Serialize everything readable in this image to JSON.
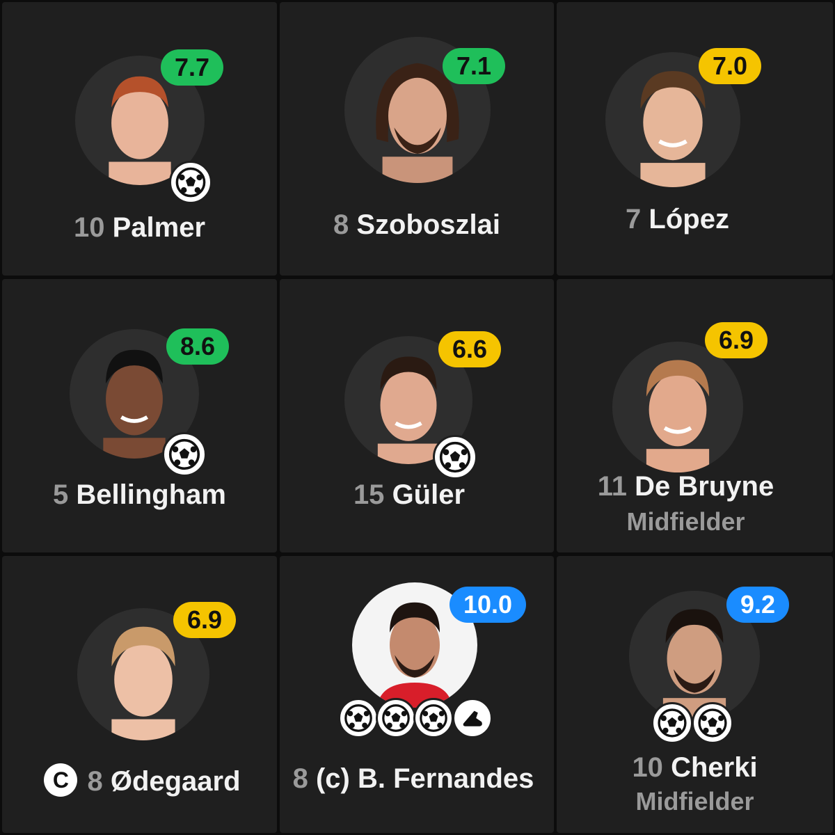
{
  "colors": {
    "green": "#1fbf5a",
    "yellow": "#f5c400",
    "blue": "#1a8cff",
    "card": "#1f1f1f"
  },
  "players": [
    {
      "number": "10",
      "name": "Palmer",
      "rating": "7.7",
      "rating_color": "green",
      "icons": [
        "ball-icon"
      ]
    },
    {
      "number": "8",
      "name": "Szoboszlai",
      "rating": "7.1",
      "rating_color": "green",
      "icons": []
    },
    {
      "number": "7",
      "name": "López",
      "rating": "7.0",
      "rating_color": "yellow",
      "icons": []
    },
    {
      "number": "5",
      "name": "Bellingham",
      "rating": "8.6",
      "rating_color": "green",
      "icons": [
        "ball-icon"
      ]
    },
    {
      "number": "15",
      "name": "Güler",
      "rating": "6.6",
      "rating_color": "yellow",
      "icons": [
        "ball-icon"
      ]
    },
    {
      "number": "11",
      "name": "De Bruyne",
      "position": "Midfielder",
      "rating": "6.9",
      "rating_color": "yellow",
      "icons": []
    },
    {
      "number": "8",
      "name": "Ødegaard",
      "captain_badge": "C",
      "rating": "6.9",
      "rating_color": "yellow",
      "icons": []
    },
    {
      "number": "8",
      "name": "(c) B. Fernandes",
      "rating": "10.0",
      "rating_color": "blue",
      "icons": [
        "ball-icon",
        "ball-icon",
        "ball-icon",
        "boot-icon"
      ]
    },
    {
      "number": "10",
      "name": "Cherki",
      "position": "Midfielder",
      "rating": "9.2",
      "rating_color": "blue",
      "icons": [
        "ball-icon",
        "ball-icon"
      ]
    }
  ]
}
